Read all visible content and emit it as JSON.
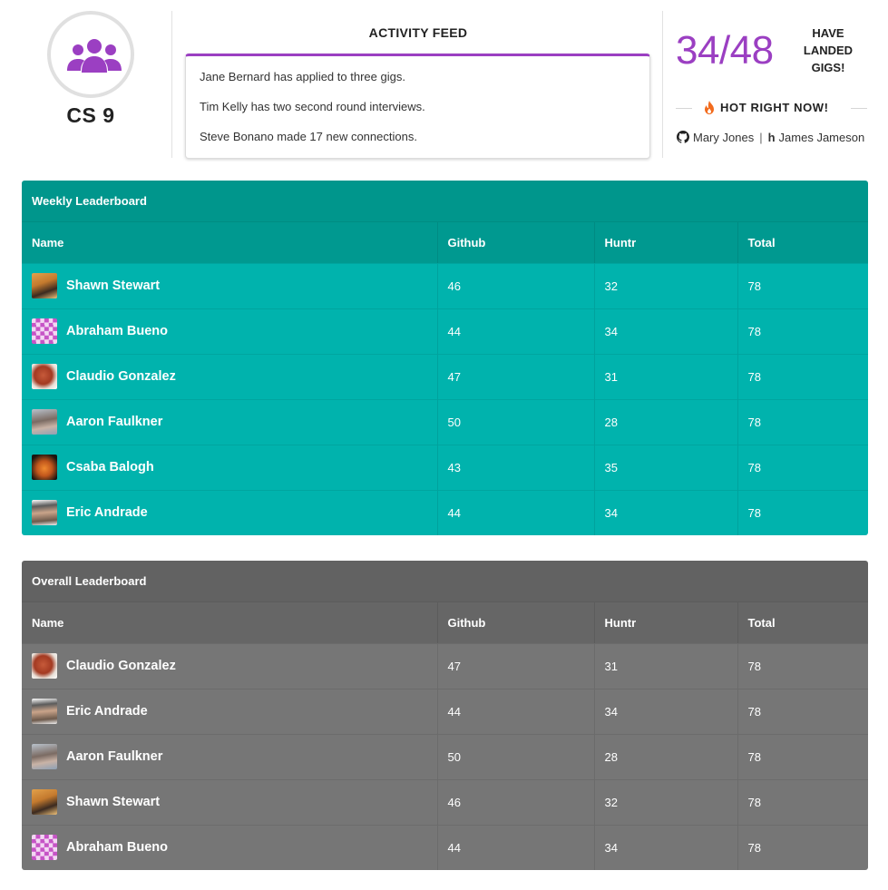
{
  "header": {
    "class_icon": "users-icon",
    "class_name": "CS 9",
    "activity_feed": {
      "title": "ACTIVITY FEED",
      "items": [
        "Jane Bernard has applied to three gigs.",
        "Tim Kelly has two second round interviews.",
        "Steve Bonano made 17 new connections."
      ]
    },
    "stats": {
      "count": "34/48",
      "label": "HAVE LANDED GIGS!"
    },
    "hot": {
      "icon": "flame-icon",
      "label": "HOT RIGHT NOW!",
      "github_person": "Mary Jones",
      "huntr_glyph": "h",
      "huntr_person": "James Jameson",
      "separator": "|"
    }
  },
  "colors": {
    "accent": "#9b3fc2",
    "weekly_title_bg": "#00968c",
    "weekly_row_bg": "#00b3ad",
    "overall_title_bg": "#626262",
    "overall_row_bg": "#767676",
    "flame": "#f26b1d"
  },
  "weekly": {
    "title": "Weekly Leaderboard",
    "columns": [
      "Name",
      "Github",
      "Huntr",
      "Total"
    ],
    "rows": [
      {
        "name": "Shawn Stewart",
        "avatar": "shawn",
        "github": "46",
        "huntr": "32",
        "total": "78"
      },
      {
        "name": "Abraham Bueno",
        "avatar": "abraham",
        "github": "44",
        "huntr": "34",
        "total": "78"
      },
      {
        "name": "Claudio Gonzalez",
        "avatar": "claudio",
        "github": "47",
        "huntr": "31",
        "total": "78"
      },
      {
        "name": "Aaron Faulkner",
        "avatar": "aaron",
        "github": "50",
        "huntr": "28",
        "total": "78"
      },
      {
        "name": "Csaba Balogh",
        "avatar": "csaba",
        "github": "43",
        "huntr": "35",
        "total": "78"
      },
      {
        "name": "Eric Andrade",
        "avatar": "eric",
        "github": "44",
        "huntr": "34",
        "total": "78"
      }
    ]
  },
  "overall": {
    "title": "Overall Leaderboard",
    "columns": [
      "Name",
      "Github",
      "Huntr",
      "Total"
    ],
    "rows": [
      {
        "name": "Claudio Gonzalez",
        "avatar": "claudio",
        "github": "47",
        "huntr": "31",
        "total": "78"
      },
      {
        "name": "Eric Andrade",
        "avatar": "eric",
        "github": "44",
        "huntr": "34",
        "total": "78"
      },
      {
        "name": "Aaron Faulkner",
        "avatar": "aaron",
        "github": "50",
        "huntr": "28",
        "total": "78"
      },
      {
        "name": "Shawn Stewart",
        "avatar": "shawn",
        "github": "46",
        "huntr": "32",
        "total": "78"
      },
      {
        "name": "Abraham Bueno",
        "avatar": "abraham",
        "github": "44",
        "huntr": "34",
        "total": "78"
      }
    ]
  }
}
